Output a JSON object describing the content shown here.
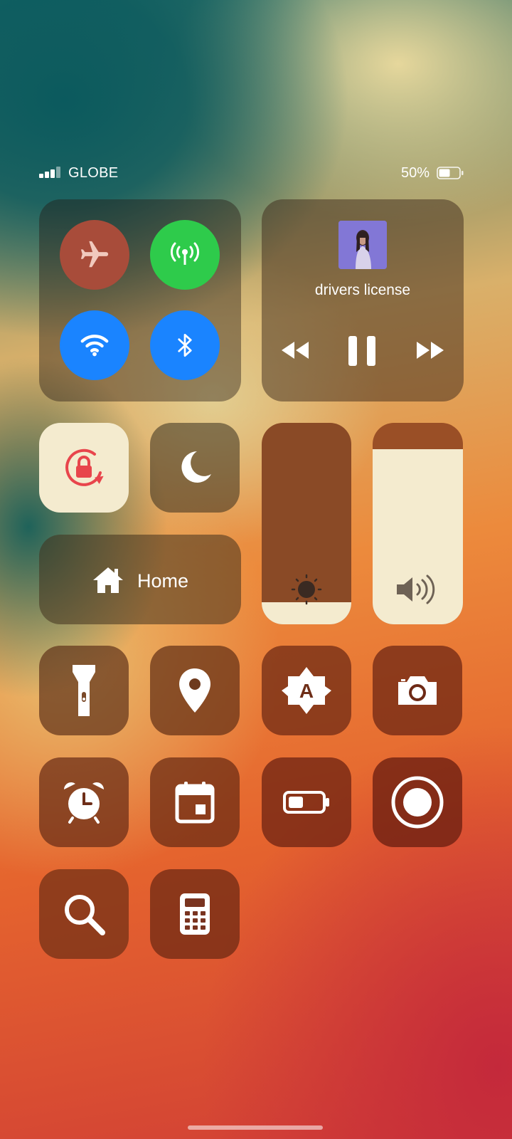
{
  "status_bar": {
    "carrier": "GLOBE",
    "battery_percent": "50%",
    "signal_level": 3,
    "battery_level": 0.5
  },
  "connectivity": {
    "airplane_mode": {
      "icon": "airplane-icon",
      "enabled": false,
      "color": "#a84c3a"
    },
    "cellular": {
      "icon": "cellular-antenna-icon",
      "enabled": true,
      "color": "#2ecb4b"
    },
    "wifi": {
      "icon": "wifi-icon",
      "enabled": true,
      "color": "#1a84ff"
    },
    "bluetooth": {
      "icon": "bluetooth-icon",
      "enabled": true,
      "color": "#1a84ff"
    }
  },
  "media": {
    "title": "drivers license",
    "album_art": "album-art",
    "controls": [
      "rewind-icon",
      "pause-icon",
      "fast-forward-icon"
    ]
  },
  "toggles": {
    "orientation_lock": {
      "icon": "orientation-lock-icon",
      "enabled": true,
      "color": "#e8454c"
    },
    "do_not_disturb": {
      "icon": "moon-icon",
      "enabled": false
    }
  },
  "home": {
    "label": "Home",
    "icon": "home-icon"
  },
  "sliders": {
    "brightness": {
      "icon": "sun-icon",
      "level": 0.11
    },
    "volume": {
      "icon": "speaker-icon",
      "level": 0.87
    }
  },
  "shortcuts": [
    {
      "name": "flashlight",
      "icon": "flashlight-icon"
    },
    {
      "name": "location",
      "icon": "location-pin-icon"
    },
    {
      "name": "auto-brightness",
      "icon": "auto-brightness-icon"
    },
    {
      "name": "camera",
      "icon": "camera-icon"
    },
    {
      "name": "alarm",
      "icon": "alarm-clock-icon"
    },
    {
      "name": "calendar",
      "icon": "calendar-icon"
    },
    {
      "name": "battery-saver",
      "icon": "battery-icon"
    },
    {
      "name": "screen-record",
      "icon": "record-icon"
    },
    {
      "name": "magnifier",
      "icon": "magnifier-icon"
    },
    {
      "name": "calculator",
      "icon": "calculator-icon"
    }
  ],
  "colors": {
    "tile_light": "#f4ebcf",
    "brightness_track": "#8a4a26",
    "volume_track": "#9a4f26"
  }
}
